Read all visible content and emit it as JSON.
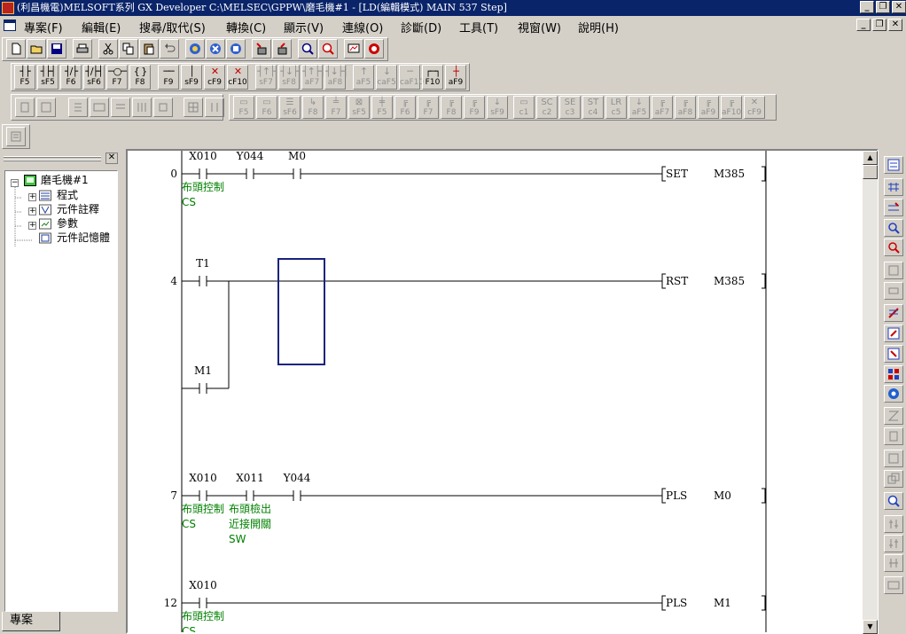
{
  "title_bar": {
    "text": "(利昌機電)MELSOFT系列 GX Developer C:\\MELSEC\\GPPW\\磨毛機#1 - [LD(編輯模式)    MAIN    537 Step]",
    "app_controls": [
      "_",
      "❐",
      "✕"
    ],
    "doc_controls": [
      "_",
      "❐",
      "✕"
    ]
  },
  "menu": {
    "items": [
      "專案(F)",
      "編輯(E)",
      "搜尋/取代(S)",
      "轉換(C)",
      "顯示(V)",
      "連線(O)",
      "診斷(D)",
      "工具(T)",
      "視窗(W)",
      "說明(H)"
    ]
  },
  "toolbar_standard": {
    "icons": [
      "new-icon",
      "open-folder-icon",
      "save-icon",
      "print-icon",
      "cut-icon",
      "copy-icon",
      "paste-icon",
      "undo-icon",
      "device-search-icon",
      "instruction-search-icon",
      "device-list-icon",
      "write-plc-icon",
      "read-plc-icon",
      "zoom-in-icon",
      "zoom-out-icon",
      "monitor-icon",
      "monitor-stop-icon"
    ]
  },
  "ladder_keys": {
    "enabled": [
      {
        "sym": "┤├",
        "label": "F5"
      },
      {
        "sym": "┤├┤",
        "label": "sF5"
      },
      {
        "sym": "┤/├",
        "label": "F6"
      },
      {
        "sym": "┤/├┤",
        "label": "sF6"
      },
      {
        "sym": "─○─",
        "label": "F7"
      },
      {
        "sym": "{ }",
        "label": "F8"
      },
      {
        "sym": "──",
        "label": "F9"
      },
      {
        "sym": "│",
        "label": "sF9"
      },
      {
        "sym": "✕",
        "label": "cF9",
        "red": true
      },
      {
        "sym": "✕",
        "label": "cF10",
        "red": true
      }
    ],
    "disabled": [
      {
        "sym": "┤↑├",
        "label": "sF7"
      },
      {
        "sym": "┤↓├",
        "label": "sF8"
      },
      {
        "sym": "┤↑├┤",
        "label": "aF7"
      },
      {
        "sym": "┤↓├┤",
        "label": "aF8"
      },
      {
        "sym": "↑",
        "label": "aF5"
      },
      {
        "sym": "↓",
        "label": "caF5"
      },
      {
        "sym": "─",
        "label": "caF10"
      }
    ],
    "tail": [
      {
        "sym": "┌─┐",
        "label": "F10"
      },
      {
        "sym": "┼",
        "label": "aF9",
        "red": true
      }
    ]
  },
  "program_keys": {
    "labels": [
      "F5",
      "F6",
      "sF6",
      "F8",
      "F7",
      "sF5",
      "F5",
      "F6",
      "F7",
      "F8",
      "F9",
      "sF9",
      "c1",
      "c2",
      "c3",
      "c4",
      "c5",
      "aF5",
      "aF7",
      "aF8",
      "aF9",
      "aF10",
      "cF9"
    ]
  },
  "project_panel": {
    "close_label": "✕",
    "root": "磨毛機#1",
    "root_expander": "−",
    "children": [
      {
        "label": "程式",
        "icon": "program-folder-icon",
        "expander": "+"
      },
      {
        "label": "元件註釋",
        "icon": "device-comment-icon",
        "expander": "+"
      },
      {
        "label": "參數",
        "icon": "parameter-icon",
        "expander": "+"
      },
      {
        "label": "元件記憶體",
        "icon": "device-memory-icon",
        "expander": ""
      }
    ],
    "tab_label": "專案"
  },
  "ladder": {
    "rungs": [
      {
        "step": "0",
        "contacts": [
          {
            "label": "X010",
            "type": "NO",
            "comment": [
              "布頭控制",
              "CS"
            ]
          },
          {
            "label": "Y044",
            "type": "NO",
            "comment": []
          },
          {
            "label": "M0",
            "type": "NO",
            "comment": []
          }
        ],
        "instruction": "SET",
        "operand": "M385"
      },
      {
        "step": "4",
        "contacts": [
          {
            "label": "T1",
            "type": "NO",
            "comment": []
          }
        ],
        "branch": {
          "label": "M1",
          "type": "NO"
        },
        "instruction": "RST",
        "operand": "M385"
      },
      {
        "step": "7",
        "contacts": [
          {
            "label": "X010",
            "type": "NO",
            "comment": [
              "布頭控制",
              "CS"
            ]
          },
          {
            "label": "X011",
            "type": "NO",
            "comment": [
              "布頭檢出",
              "近接開關",
              "SW"
            ]
          },
          {
            "label": "Y044",
            "type": "NO",
            "comment": []
          }
        ],
        "instruction": "PLS",
        "operand": "M0"
      },
      {
        "step": "12",
        "contacts": [
          {
            "label": "X010",
            "type": "NO",
            "comment": [
              "布頭控制",
              "CS"
            ]
          }
        ],
        "instruction": "PLS",
        "operand": "M1"
      }
    ]
  },
  "colors": {
    "title_bg": "#0a246a",
    "comment_green": "#008000",
    "cursor_blue": "#1a237e",
    "chrome": "#d4d0c8"
  }
}
